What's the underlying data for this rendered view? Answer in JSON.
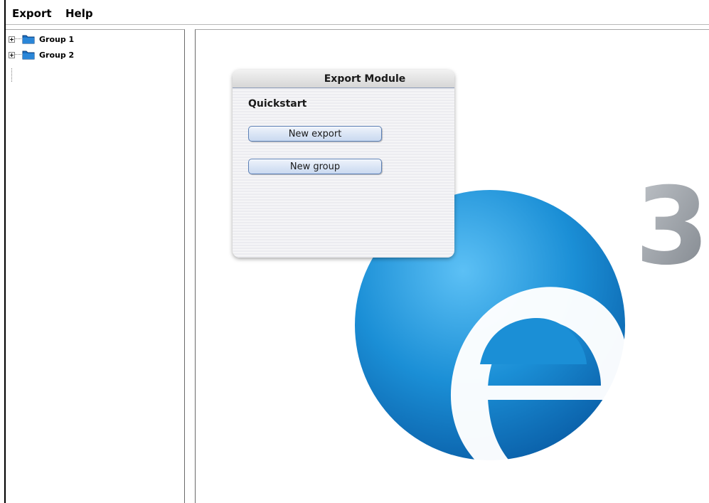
{
  "menu": {
    "items": [
      {
        "label": "Export"
      },
      {
        "label": "Help"
      }
    ]
  },
  "tree": {
    "items": [
      {
        "label": "Group 1",
        "icon": "folder-icon",
        "expander": "plus"
      },
      {
        "label": "Group 2",
        "icon": "folder-icon",
        "expander": "plus"
      }
    ]
  },
  "panel": {
    "title": "Export Module",
    "subtitle": "Quickstart",
    "buttons": [
      {
        "label": "New export"
      },
      {
        "label": "New group"
      }
    ]
  },
  "logo": {
    "letter": "e",
    "superscript": "3",
    "colors": {
      "primary": "#1b8fd6",
      "dark": "#0a5fa8",
      "digit": "#9aa0a6"
    }
  }
}
